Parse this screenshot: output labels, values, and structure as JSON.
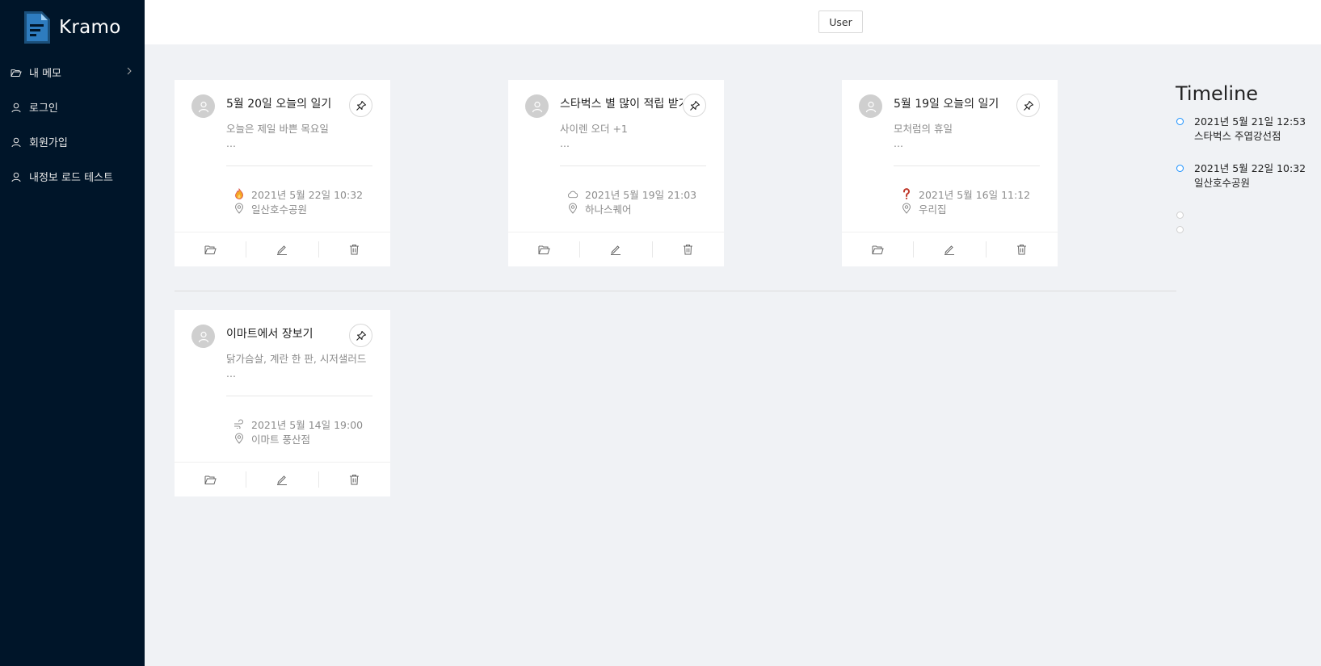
{
  "app": {
    "name": "Kramo"
  },
  "sidebar": {
    "items": [
      {
        "label": "내 메모",
        "icon": "folder-open-icon",
        "has_submenu": true
      },
      {
        "label": "로그인",
        "icon": "user-icon"
      },
      {
        "label": "회원가입",
        "icon": "user-icon"
      },
      {
        "label": "내정보 로드 테스트",
        "icon": "user-icon"
      }
    ]
  },
  "header": {
    "user_button": "User"
  },
  "cards": [
    {
      "title": "5월 20일 오늘의 일기",
      "desc": "오늘은 제일 바쁜 목요일",
      "more": "...",
      "weather_icon": "fire-icon",
      "datetime": "2021년 5월 22일 10:32",
      "location": "일산호수공원"
    },
    {
      "title": "스타벅스 별 많이 적립 받기",
      "desc": "사이렌 오더 +1",
      "more": "...",
      "weather_icon": "cloud-icon",
      "datetime": "2021년 5월 19일 21:03",
      "location": "하나스퀘어"
    },
    {
      "title": "5월 19일 오늘의 일기",
      "desc": "모처럼의 휴일",
      "more": "...",
      "weather_icon": "question-icon",
      "datetime": "2021년 5월 16일 11:12",
      "location": "우리집"
    },
    {
      "title": "이마트에서 장보기",
      "desc": "닭가슴살, 계란 한 판, 시저샐러드",
      "more": "...",
      "weather_icon": "wind-icon",
      "datetime": "2021년 5월 14일 19:00",
      "location": "이마트 풍산점"
    }
  ],
  "timeline": {
    "title": "Timeline",
    "items": [
      {
        "time": "2021년 5월 21일 12:53",
        "place": "스타벅스 주엽강선점",
        "color": "#1890ff"
      },
      {
        "time": "2021년 5월 22일 10:32",
        "place": "일산호수공원",
        "color": "#1890ff"
      },
      {
        "time": "",
        "place": "",
        "color": "#d0d0d0"
      },
      {
        "time": "",
        "place": "",
        "color": "#d0d0d0"
      }
    ]
  },
  "colors": {
    "sidebar_bg": "#001529",
    "content_bg": "#f0f2f5",
    "accent": "#1890ff"
  }
}
